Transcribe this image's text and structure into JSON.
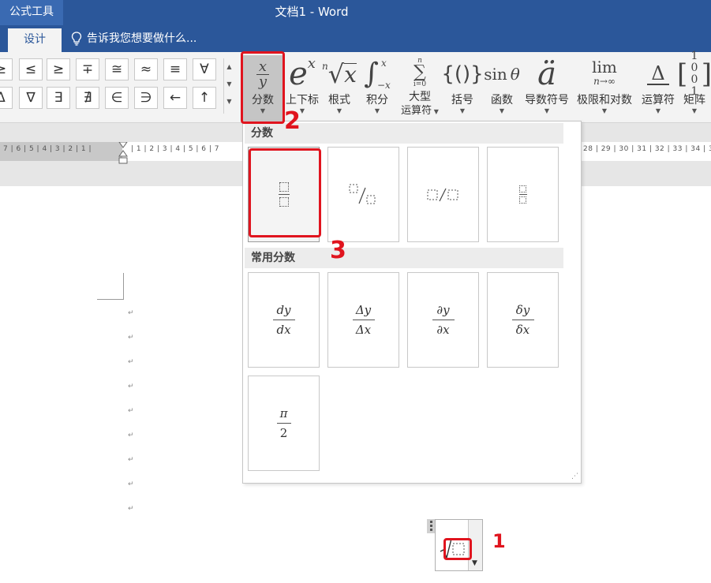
{
  "titlebar": {
    "context_tab": "公式工具",
    "doc_title": "文档1 - Word"
  },
  "tabs": {
    "design": "设计",
    "tell_me": "告诉我您想要做什么..."
  },
  "symbols": {
    "row1": [
      "≥",
      "≤",
      "≥",
      "∓",
      "≅",
      "≈",
      "≡",
      "∀"
    ],
    "row2": [
      "Δ",
      "∇",
      "∃",
      "∄",
      "∈",
      "∋",
      "←",
      "↑"
    ]
  },
  "tools": [
    {
      "label": "分数",
      "icon": "fraction-icon"
    },
    {
      "label": "上下标",
      "icon": "script-icon"
    },
    {
      "label": "根式",
      "icon": "radical-icon"
    },
    {
      "label": "积分",
      "icon": "integral-icon"
    },
    {
      "label": "大型",
      "label2": "运算符",
      "icon": "large-operator-icon"
    },
    {
      "label": "括号",
      "icon": "bracket-icon"
    },
    {
      "label": "函数",
      "icon": "function-icon"
    },
    {
      "label": "导数符号",
      "icon": "accent-icon"
    },
    {
      "label": "极限和对数",
      "icon": "limit-icon"
    },
    {
      "label": "运算符",
      "icon": "operator-icon"
    },
    {
      "label": "矩阵",
      "icon": "matrix-icon"
    }
  ],
  "ruler": {
    "left": "7 | 6 | 5 | 4 | 3 | 2 | 1 |",
    "mid": "| 1 | 2 | 3 | 4 | 5 | 6 | 7",
    "right": "28 | 29 | 30 | 31 | 32 | 33 | 34 | 35"
  },
  "dropdown": {
    "section1": "分数",
    "section2": "常用分数",
    "common": [
      {
        "num": "dy",
        "den": "dx"
      },
      {
        "num": "Δy",
        "den": "Δx"
      },
      {
        "num": "∂y",
        "den": "∂x"
      },
      {
        "num": "δy",
        "den": "δx"
      },
      {
        "num": "π",
        "den": "2"
      }
    ]
  },
  "annotations": {
    "step1": "1",
    "step2": "2",
    "step3": "3"
  },
  "colors": {
    "brand": "#2b579a",
    "annotation": "#e0141e"
  }
}
